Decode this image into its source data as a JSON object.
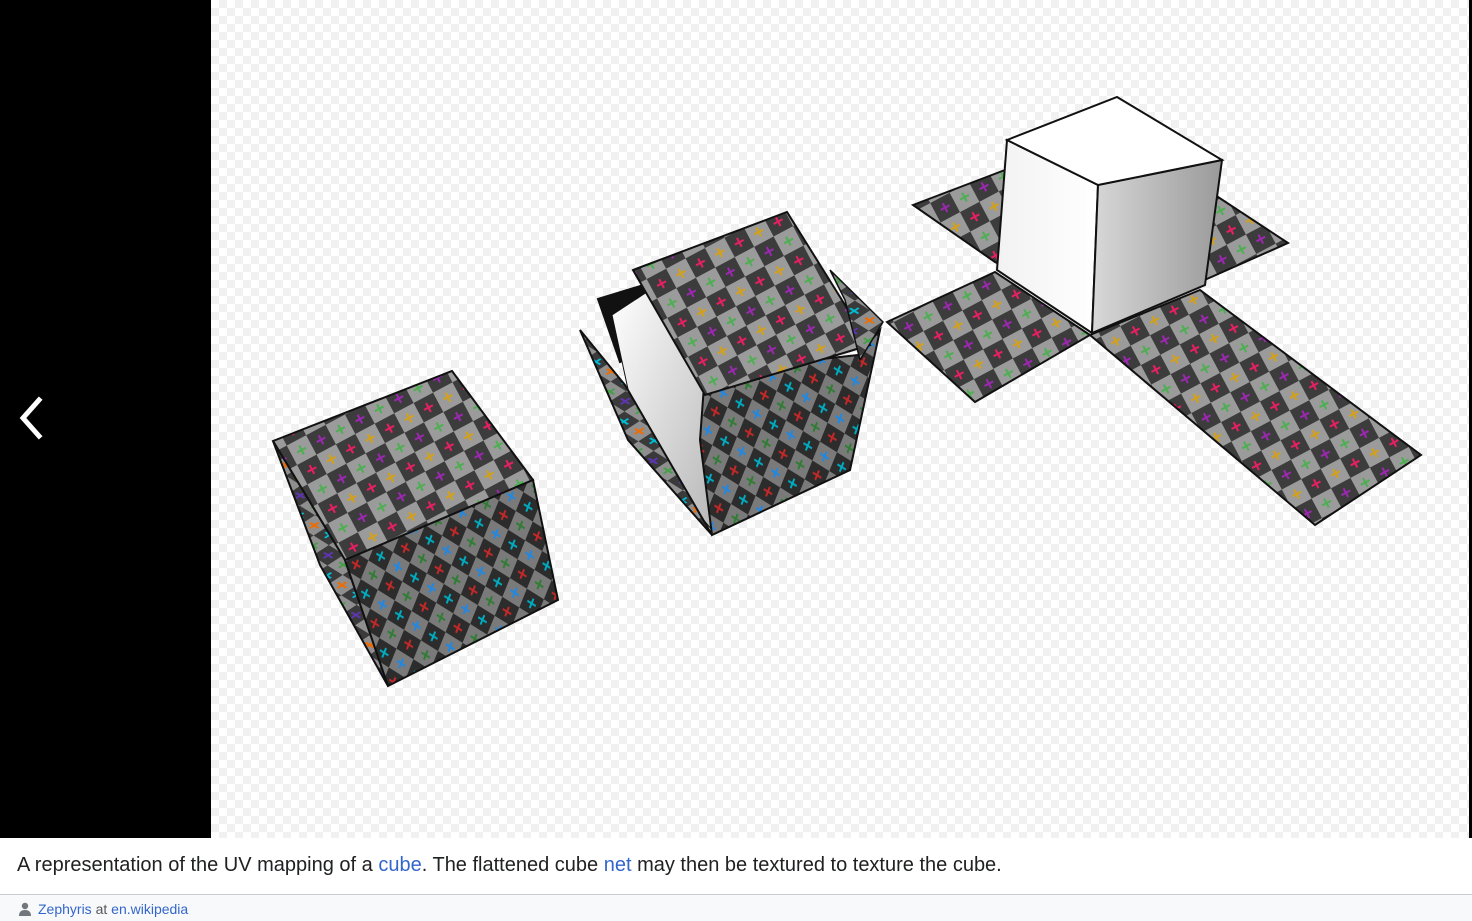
{
  "viewer": {
    "prev_icon": "chevron-left-icon",
    "image_subject": "UV mapping of a cube"
  },
  "caption": {
    "before_cube": "A representation of the UV mapping of a ",
    "cube_link": "cube",
    "after_cube": ". The flattened cube ",
    "net_link": "net",
    "after_net": " may then be textured to texture the cube."
  },
  "attribution": {
    "user_icon": "user-icon",
    "author": "Zephyris",
    "separator": " at ",
    "source": "en.wikipedia"
  },
  "colors": {
    "link": "#3366cc",
    "text": "#202122",
    "viewer_background": "#000000",
    "checker_dark": "#3c3c3c",
    "checker_light": "#9b9b9b"
  }
}
